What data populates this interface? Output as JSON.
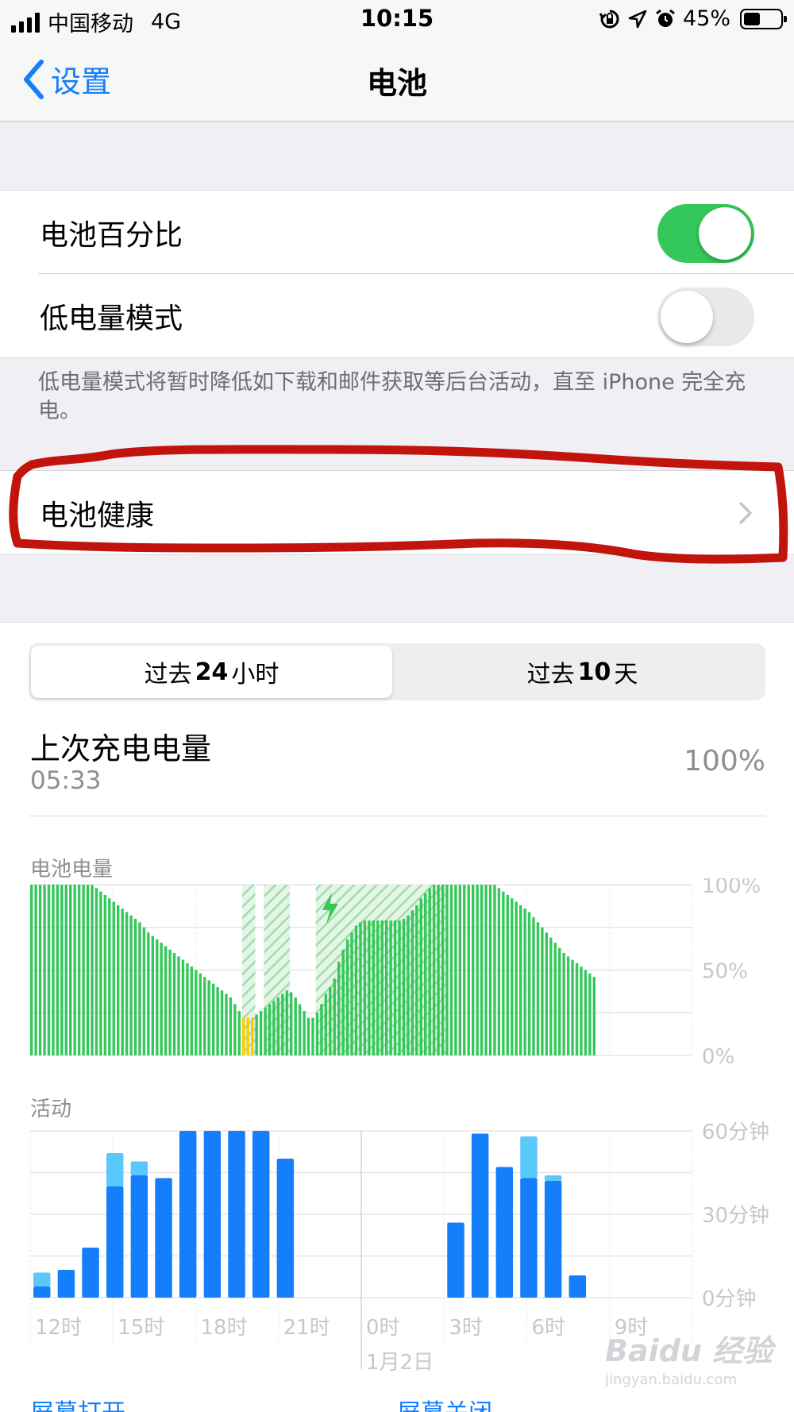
{
  "status_bar": {
    "carrier": "中国移动",
    "network": "4G",
    "time": "10:15",
    "battery_text": "45%",
    "battery_level": 0.45
  },
  "nav": {
    "back_label": "设置",
    "title": "电池"
  },
  "settings": {
    "battery_percentage": {
      "label": "电池百分比",
      "on": true
    },
    "low_power": {
      "label": "低电量模式",
      "on": false
    },
    "footnote": "低电量模式将暂时降低如下载和邮件获取等后台活动，直至 iPhone 完全充电。",
    "battery_health": {
      "label": "电池健康"
    }
  },
  "usage": {
    "tabs": [
      {
        "pre": "过去",
        "num": "24",
        "post": "小时",
        "active": true
      },
      {
        "pre": "过去",
        "num": "10",
        "post": "天",
        "active": false
      }
    ],
    "last_charge_title": "上次充电电量",
    "last_charge_time": "05:33",
    "last_charge_value": "100%",
    "footer_links": {
      "screen_on": "屏幕打开",
      "screen_off": "屏幕关闭"
    }
  },
  "colors": {
    "accent": "#147efb",
    "toggle_on": "#34c759",
    "battery_green": "#34c759",
    "low_battery": "#ffcc00",
    "activity_screen_on": "#147efb",
    "activity_screen_off": "#5ac8fa",
    "highlight_red": "#c0140c"
  },
  "chart_data": [
    {
      "type": "bar",
      "title": "电池电量",
      "y_ticks": [
        "100%",
        "50%",
        "0%"
      ],
      "ylim": [
        0,
        100
      ],
      "values": [
        100,
        100,
        100,
        100,
        100,
        100,
        100,
        100,
        100,
        100,
        100,
        100,
        100,
        100,
        100,
        98,
        96,
        94,
        92,
        90,
        88,
        86,
        84,
        82,
        80,
        78,
        75,
        72,
        70,
        68,
        66,
        64,
        62,
        60,
        58,
        56,
        54,
        52,
        50,
        48,
        46,
        44,
        42,
        40,
        38,
        36,
        34,
        30,
        26,
        22,
        22,
        22,
        24,
        26,
        28,
        30,
        32,
        34,
        36,
        38,
        37,
        34,
        30,
        26,
        22,
        22,
        25,
        30,
        36,
        40,
        45,
        55,
        62,
        68,
        72,
        76,
        78,
        79,
        79,
        79,
        79,
        79,
        79,
        79,
        79,
        79,
        80,
        82,
        85,
        88,
        92,
        95,
        98,
        100,
        100,
        100,
        100,
        100,
        100,
        100,
        100,
        100,
        100,
        100,
        100,
        100,
        100,
        100,
        98,
        96,
        94,
        92,
        90,
        88,
        86,
        84,
        81,
        78,
        75,
        72,
        69,
        66,
        63,
        60,
        58,
        56,
        54,
        52,
        50,
        48,
        46
      ],
      "low_indices": [
        49,
        50,
        51
      ],
      "charging_bands": [
        [
          49,
          51
        ],
        [
          54,
          59
        ],
        [
          66,
          80
        ],
        [
          80,
          95
        ]
      ]
    },
    {
      "type": "bar",
      "stacked": true,
      "title": "活动",
      "y_ticks": [
        "60分钟",
        "30分钟",
        "0分钟"
      ],
      "ylim": [
        0,
        60
      ],
      "x_tick_labels": [
        "12时",
        "15时",
        "18时",
        "21时",
        "0时",
        "3时",
        "6时",
        "9时"
      ],
      "date_label": "1月2日",
      "series": [
        {
          "name": "屏幕打开",
          "values": [
            4,
            10,
            18,
            40,
            44,
            43,
            60,
            60,
            60,
            60,
            50,
            0,
            0,
            0,
            0,
            0,
            0,
            27,
            59,
            47,
            43,
            42,
            8
          ]
        },
        {
          "name": "屏幕关闭",
          "values": [
            5,
            0,
            0,
            12,
            5,
            0,
            0,
            0,
            0,
            0,
            0,
            0,
            0,
            0,
            0,
            0,
            0,
            0,
            0,
            0,
            15,
            2,
            0
          ]
        }
      ]
    }
  ]
}
